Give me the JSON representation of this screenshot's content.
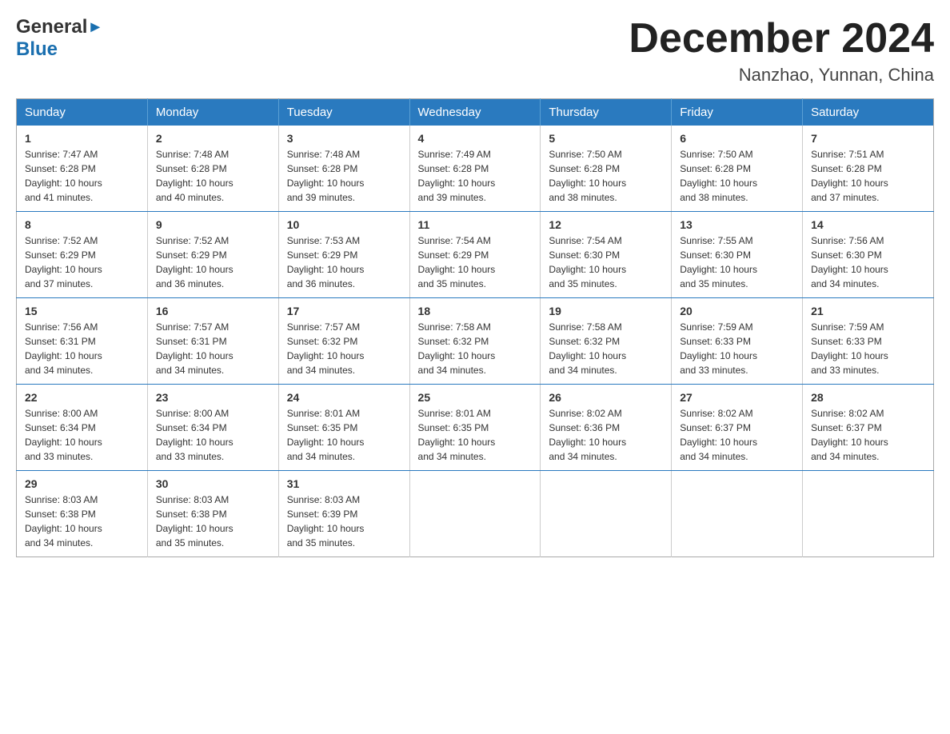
{
  "header": {
    "logo_general": "General",
    "logo_blue": "Blue",
    "month_title": "December 2024",
    "location": "Nanzhao, Yunnan, China"
  },
  "days_of_week": [
    "Sunday",
    "Monday",
    "Tuesday",
    "Wednesday",
    "Thursday",
    "Friday",
    "Saturday"
  ],
  "weeks": [
    [
      {
        "day": "1",
        "sunrise": "7:47 AM",
        "sunset": "6:28 PM",
        "daylight": "10 hours and 41 minutes."
      },
      {
        "day": "2",
        "sunrise": "7:48 AM",
        "sunset": "6:28 PM",
        "daylight": "10 hours and 40 minutes."
      },
      {
        "day": "3",
        "sunrise": "7:48 AM",
        "sunset": "6:28 PM",
        "daylight": "10 hours and 39 minutes."
      },
      {
        "day": "4",
        "sunrise": "7:49 AM",
        "sunset": "6:28 PM",
        "daylight": "10 hours and 39 minutes."
      },
      {
        "day": "5",
        "sunrise": "7:50 AM",
        "sunset": "6:28 PM",
        "daylight": "10 hours and 38 minutes."
      },
      {
        "day": "6",
        "sunrise": "7:50 AM",
        "sunset": "6:28 PM",
        "daylight": "10 hours and 38 minutes."
      },
      {
        "day": "7",
        "sunrise": "7:51 AM",
        "sunset": "6:28 PM",
        "daylight": "10 hours and 37 minutes."
      }
    ],
    [
      {
        "day": "8",
        "sunrise": "7:52 AM",
        "sunset": "6:29 PM",
        "daylight": "10 hours and 37 minutes."
      },
      {
        "day": "9",
        "sunrise": "7:52 AM",
        "sunset": "6:29 PM",
        "daylight": "10 hours and 36 minutes."
      },
      {
        "day": "10",
        "sunrise": "7:53 AM",
        "sunset": "6:29 PM",
        "daylight": "10 hours and 36 minutes."
      },
      {
        "day": "11",
        "sunrise": "7:54 AM",
        "sunset": "6:29 PM",
        "daylight": "10 hours and 35 minutes."
      },
      {
        "day": "12",
        "sunrise": "7:54 AM",
        "sunset": "6:30 PM",
        "daylight": "10 hours and 35 minutes."
      },
      {
        "day": "13",
        "sunrise": "7:55 AM",
        "sunset": "6:30 PM",
        "daylight": "10 hours and 35 minutes."
      },
      {
        "day": "14",
        "sunrise": "7:56 AM",
        "sunset": "6:30 PM",
        "daylight": "10 hours and 34 minutes."
      }
    ],
    [
      {
        "day": "15",
        "sunrise": "7:56 AM",
        "sunset": "6:31 PM",
        "daylight": "10 hours and 34 minutes."
      },
      {
        "day": "16",
        "sunrise": "7:57 AM",
        "sunset": "6:31 PM",
        "daylight": "10 hours and 34 minutes."
      },
      {
        "day": "17",
        "sunrise": "7:57 AM",
        "sunset": "6:32 PM",
        "daylight": "10 hours and 34 minutes."
      },
      {
        "day": "18",
        "sunrise": "7:58 AM",
        "sunset": "6:32 PM",
        "daylight": "10 hours and 34 minutes."
      },
      {
        "day": "19",
        "sunrise": "7:58 AM",
        "sunset": "6:32 PM",
        "daylight": "10 hours and 34 minutes."
      },
      {
        "day": "20",
        "sunrise": "7:59 AM",
        "sunset": "6:33 PM",
        "daylight": "10 hours and 33 minutes."
      },
      {
        "day": "21",
        "sunrise": "7:59 AM",
        "sunset": "6:33 PM",
        "daylight": "10 hours and 33 minutes."
      }
    ],
    [
      {
        "day": "22",
        "sunrise": "8:00 AM",
        "sunset": "6:34 PM",
        "daylight": "10 hours and 33 minutes."
      },
      {
        "day": "23",
        "sunrise": "8:00 AM",
        "sunset": "6:34 PM",
        "daylight": "10 hours and 33 minutes."
      },
      {
        "day": "24",
        "sunrise": "8:01 AM",
        "sunset": "6:35 PM",
        "daylight": "10 hours and 34 minutes."
      },
      {
        "day": "25",
        "sunrise": "8:01 AM",
        "sunset": "6:35 PM",
        "daylight": "10 hours and 34 minutes."
      },
      {
        "day": "26",
        "sunrise": "8:02 AM",
        "sunset": "6:36 PM",
        "daylight": "10 hours and 34 minutes."
      },
      {
        "day": "27",
        "sunrise": "8:02 AM",
        "sunset": "6:37 PM",
        "daylight": "10 hours and 34 minutes."
      },
      {
        "day": "28",
        "sunrise": "8:02 AM",
        "sunset": "6:37 PM",
        "daylight": "10 hours and 34 minutes."
      }
    ],
    [
      {
        "day": "29",
        "sunrise": "8:03 AM",
        "sunset": "6:38 PM",
        "daylight": "10 hours and 34 minutes."
      },
      {
        "day": "30",
        "sunrise": "8:03 AM",
        "sunset": "6:38 PM",
        "daylight": "10 hours and 35 minutes."
      },
      {
        "day": "31",
        "sunrise": "8:03 AM",
        "sunset": "6:39 PM",
        "daylight": "10 hours and 35 minutes."
      },
      null,
      null,
      null,
      null
    ]
  ],
  "labels": {
    "sunrise": "Sunrise:",
    "sunset": "Sunset:",
    "daylight": "Daylight:"
  }
}
